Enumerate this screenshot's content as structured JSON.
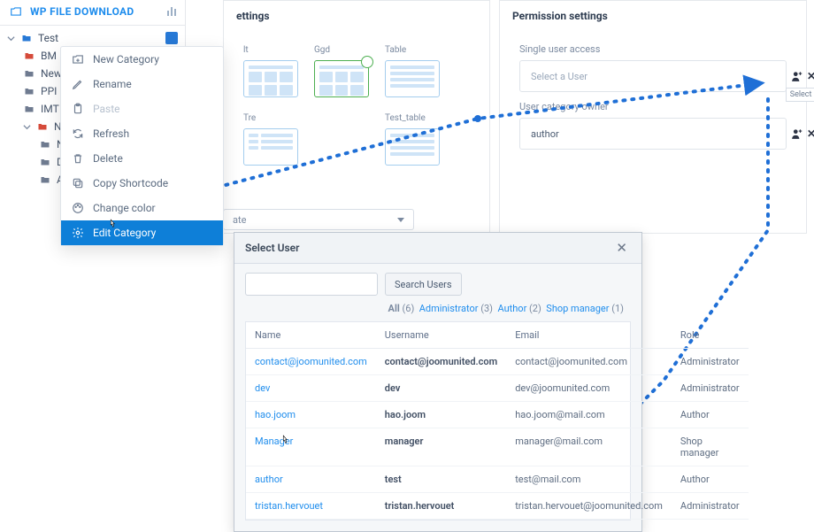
{
  "brand": {
    "title": "WP FILE DOWNLOAD"
  },
  "tree": {
    "root": "Test",
    "children1": [
      "BM",
      "New",
      "PPI",
      "IMT"
    ],
    "sub_root": "New",
    "children2": [
      "Nc",
      "Des",
      "Ado"
    ],
    "folder_colors": {
      "root": "#2779d6",
      "0": "#d54a3a",
      "1": "#6f7b90",
      "2": "#6f7b90",
      "3": "#6f7b90",
      "sub_root": "#d54a3a",
      "c0": "#6f7b90",
      "c1": "#6f7b90",
      "c2": "#6f7b90"
    }
  },
  "ctx_menu": {
    "items": [
      {
        "id": "new-category",
        "label": "New Category",
        "icon": "plus-folder"
      },
      {
        "id": "rename",
        "label": "Rename",
        "icon": "pencil"
      },
      {
        "id": "paste",
        "label": "Paste",
        "icon": "paste",
        "disabled": true
      },
      {
        "id": "refresh",
        "label": "Refresh",
        "icon": "refresh"
      },
      {
        "id": "delete",
        "label": "Delete",
        "icon": "trash"
      },
      {
        "id": "copy-shortcode",
        "label": "Copy Shortcode",
        "icon": "copy"
      },
      {
        "id": "change-color",
        "label": "Change color",
        "icon": "palette"
      },
      {
        "id": "edit-category",
        "label": "Edit Category",
        "icon": "gear",
        "active": true
      }
    ]
  },
  "settings_panel": {
    "title": "ettings",
    "themes": [
      "lt",
      "Ggd",
      "Table",
      "Tre",
      "Test_table"
    ],
    "selected_index": 1,
    "date_label": "ate"
  },
  "perm_panel": {
    "title": "Permission settings",
    "single_user_label": "Single user access",
    "single_user_placeholder": "Select a User",
    "owner_label": "User category owner",
    "owner_value": "author",
    "tooltip": "Select User"
  },
  "modal": {
    "title": "Select User",
    "search_btn": "Search Users",
    "filters": {
      "all_label": "All",
      "all_count": "(6)",
      "admin_label": "Administrator",
      "admin_count": "(3)",
      "author_label": "Author",
      "author_count": "(2)",
      "shop_label": "Shop manager",
      "shop_count": "(1)"
    },
    "columns": [
      "Name",
      "Username",
      "Email",
      "Role"
    ],
    "rows": [
      {
        "name": "contact@joomunited.com",
        "username": "contact@joomunited.com",
        "email": "contact@joomunited.com",
        "role": "Administrator"
      },
      {
        "name": "dev",
        "username": "dev",
        "email": "dev@joomunited.com",
        "role": "Administrator"
      },
      {
        "name": "hao.joom",
        "username": "hao.joom",
        "email": "hao.joom@mail.com",
        "role": "Author"
      },
      {
        "name": "Manager",
        "username": "manager",
        "email": "manager@mail.com",
        "role": "Shop manager"
      },
      {
        "name": "author",
        "username": "test",
        "email": "test@mail.com",
        "role": "Author"
      },
      {
        "name": "tristan.hervouet",
        "username": "tristan.hervouet",
        "email": "tristan.hervouet@joomunited.com",
        "role": "Administrator"
      }
    ]
  }
}
